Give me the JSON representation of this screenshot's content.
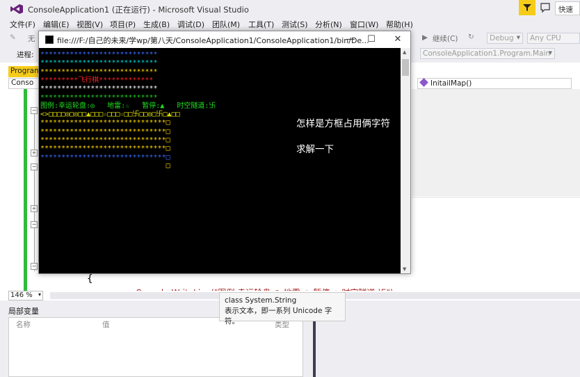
{
  "vs": {
    "title": "ConsoleApplication1 (正在运行) - Microsoft Visual Studio",
    "quick_launch": "快速",
    "menu": [
      "文件(F)",
      "编辑(E)",
      "视图(V)",
      "项目(P)",
      "生成(B)",
      "调试(D)",
      "团队(M)",
      "工具(T)",
      "测试(S)",
      "分析(N)",
      "窗口(W)",
      "帮助(H)"
    ],
    "toolbar1": {
      "left_text": "无",
      "continue": "继续(C)",
      "config": "Debug",
      "platform": "Any CPU"
    },
    "toolbar2": {
      "process_label": "进程:",
      "stack": "ConsoleApplication1.Program.Main"
    },
    "doc_tab": "Program",
    "nav_left": "Conso",
    "nav_right": "InitailMap()",
    "code_brace": "{",
    "code_partial": "Console.WriteLine(\"图例:幸运轮盘:◎   地雷:☆   暂停:▲   时空隧道:卐\");",
    "zoom": "146 %",
    "locals": {
      "title": "局部变量",
      "col_name": "名称",
      "col_value": "值",
      "col_type": "类型"
    },
    "tooltip": {
      "line1": "class System.String",
      "line2": "表示文本，即一系列 Unicode 字符。"
    },
    "colors": {
      "accent": "#f5cc1a",
      "green_margin": "#2fbb3c",
      "console_bg": "#000000"
    }
  },
  "console": {
    "title": "file:///F:/自己的未来/学wp/第八天/ConsoleApplication1/ConsoleApplication1/bin/De...",
    "lines": [
      {
        "text": "****************************",
        "color": "#3a6bff"
      },
      {
        "text": "****************************",
        "color": "#00d7d7"
      },
      {
        "text": "****************************",
        "color": "#ffd700"
      },
      {
        "text": "*********飞行棋*************",
        "color": "#ff2020"
      },
      {
        "text": "****************************",
        "color": "#ffffff"
      },
      {
        "text": "****************************",
        "color": "#20d020"
      },
      {
        "text": "图例:幸运轮盘:◎   地雷:☆   暂停:▲   时空隧道:卐",
        "color": "#20e020"
      },
      {
        "text": "<>□□□□◎□◎□□▲□□□☆□□□☆□□卐□□◎□卐□▲□□",
        "color": "#e0e000"
      },
      {
        "text": "******************************□",
        "color": "#ffd700"
      },
      {
        "text": "******************************□",
        "color": "#ffd700"
      },
      {
        "text": "******************************□",
        "color": "#ffd700"
      },
      {
        "text": "******************************□",
        "color": "#ffd700"
      },
      {
        "text": "******************************□",
        "color": "#3a6bff"
      },
      {
        "text": "                              □",
        "color": "#ffd700"
      }
    ],
    "note1": "怎样是方框占用俩字符",
    "note2": "求解一下",
    "btn_min": "—",
    "btn_max": "☐",
    "btn_close": "✕"
  }
}
